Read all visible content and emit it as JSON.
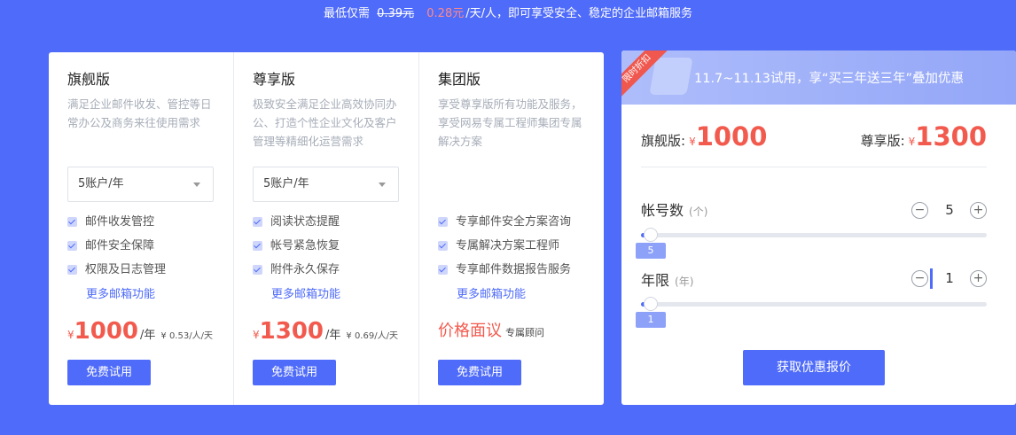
{
  "banner": {
    "prefix": "最低仅需",
    "old_price": "0.39元",
    "new_price": "0.28元",
    "suffix": "/天/人，即可享受安全、稳定的企业邮箱服务"
  },
  "plans": [
    {
      "title": "旗舰版",
      "desc": "满足企业邮件收发、管控等日常办公及商务来往使用需求",
      "select": "5账户/年",
      "features": [
        "邮件收发管控",
        "邮件安全保障",
        "权限及日志管理"
      ],
      "more": "更多邮箱功能",
      "currency": "¥",
      "price": "1000",
      "unit": "/年",
      "per_day": "¥ 0.53/人/天",
      "cta": "免费试用"
    },
    {
      "title": "尊享版",
      "desc": "极致安全满足企业高效协同办公、打造个性企业文化及客户管理等精细化运营需求",
      "select": "5账户/年",
      "features": [
        "阅读状态提醒",
        "帐号紧急恢复",
        "附件永久保存"
      ],
      "more": "更多邮箱功能",
      "currency": "¥",
      "price": "1300",
      "unit": "/年",
      "per_day": "¥ 0.69/人/天",
      "cta": "免费试用"
    },
    {
      "title": "集团版",
      "desc": "享受尊享版所有功能及服务，享受网易专属工程师集团专属解决方案",
      "features": [
        "专享邮件安全方案咨询",
        "专属解决方案工程师",
        "专享邮件数据报告服务"
      ],
      "more": "更多邮箱功能",
      "quote": "价格面议",
      "consult": "专属顾问",
      "cta": "免费试用"
    }
  ],
  "promo": {
    "ribbon": "限时折扣",
    "headline": "11.7~11.13试用，享“买三年送三年”叠加优惠",
    "left_label": "旗舰版:",
    "left_currency": "¥",
    "left_price": "1000",
    "right_label": "尊享版:",
    "right_currency": "¥",
    "right_price": "1300",
    "accounts_label": "帐号数",
    "accounts_unit": "(个)",
    "accounts_value": "5",
    "accounts_slider_value": 5,
    "years_label": "年限",
    "years_unit": "(年)",
    "years_value": "1",
    "years_slider_value": 1,
    "minus": "−",
    "plus": "+",
    "cta": "获取优惠报价"
  },
  "colors": {
    "brand": "#4f6bfa",
    "price": "#f25a4e"
  }
}
